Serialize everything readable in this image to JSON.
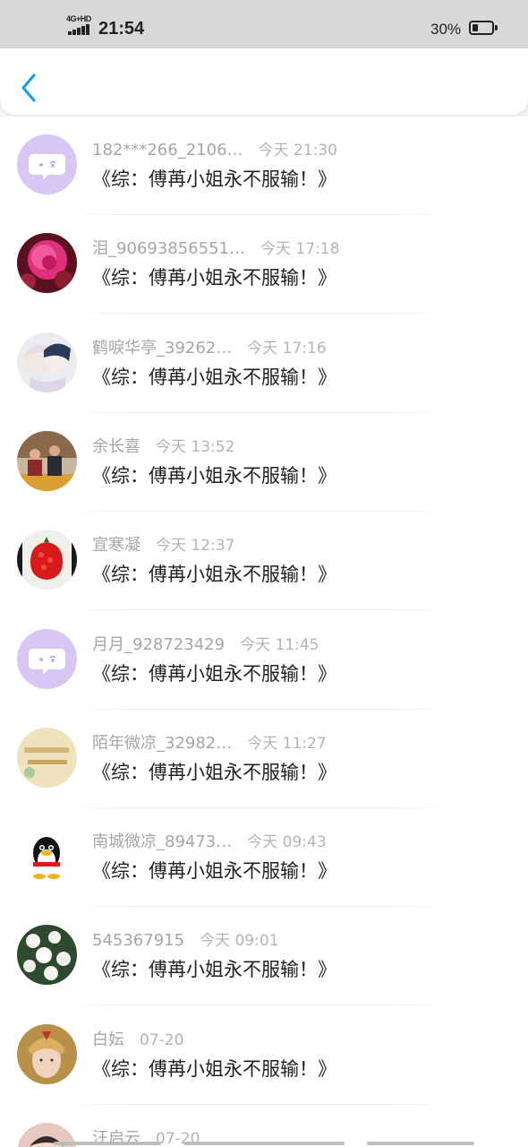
{
  "status_bar": {
    "network": "4G+HD",
    "time": "21:54",
    "battery_percent": "30%",
    "battery_level": 0.3
  },
  "colors": {
    "accent": "#1e9bf0",
    "name_gray": "#a6a6a6",
    "message_black": "#222222",
    "bubble_avatar_bg": "#d9c6f5"
  },
  "nav": {
    "back_icon": "chevron-left-icon"
  },
  "messages": [
    {
      "name": "182***266_2106…",
      "time": "今天 21:30",
      "text": "《综：傅苒小姐永不服输！》",
      "avatar": "chat-bubble-avatar"
    },
    {
      "name": "泪_90693856551…",
      "time": "今天 17:18",
      "text": "《综：傅苒小姐永不服输！》",
      "avatar": "pink-flower-avatar"
    },
    {
      "name": "鹤唳华亭_39262…",
      "time": "今天 17:16",
      "text": "《综：傅苒小姐永不服输！》",
      "avatar": "anime-couple-avatar"
    },
    {
      "name": "余长喜",
      "time": "今天 13:52",
      "text": "《综：傅苒小姐永不服输！》",
      "avatar": "people-photo-avatar"
    },
    {
      "name": "宣寒凝",
      "time": "今天 12:37",
      "text": "《综：傅苒小姐永不服输！》",
      "avatar": "red-fruit-avatar"
    },
    {
      "name": "月月_928723429",
      "time": "今天 11:45",
      "text": "《综：傅苒小姐永不服输！》",
      "avatar": "chat-bubble-avatar"
    },
    {
      "name": "陌年微凉_32982…",
      "time": "今天 11:27",
      "text": "《综：傅苒小姐永不服输！》",
      "avatar": "text-image-avatar"
    },
    {
      "name": "南城微凉_89473…",
      "time": "今天 09:43",
      "text": "《综：傅苒小姐永不服输！》",
      "avatar": "penguin-avatar"
    },
    {
      "name": "545367915",
      "time": "今天 09:01",
      "text": "《综：傅苒小姐永不服输！》",
      "avatar": "white-flowers-avatar"
    },
    {
      "name": "白妘",
      "time": "07-20",
      "text": "《综：傅苒小姐永不服输！》",
      "avatar": "character-portrait-avatar"
    },
    {
      "name": "汪启云",
      "time": "07-20",
      "text": "",
      "avatar": "child-photo-avatar"
    }
  ]
}
